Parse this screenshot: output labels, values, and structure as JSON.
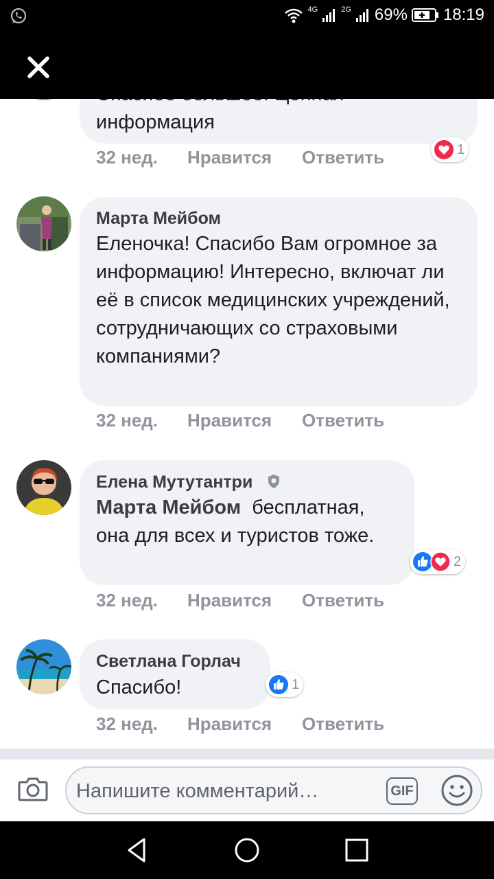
{
  "status_bar": {
    "network_1": "4G",
    "network_2": "2G",
    "battery": "69%",
    "time": "18:19"
  },
  "comments": [
    {
      "author": "",
      "text": "Спасибо большое! Ценная информация",
      "time": "32 нед.",
      "like_label": "Нравится",
      "reply_label": "Ответить",
      "reactions": [
        "heart"
      ],
      "reaction_count": "1"
    },
    {
      "author": "Марта Мейбом",
      "text": "Еленочка! Спасибо Вам огромное за информацию! Интересно, включат ли её в список медицинских учреждений, сотрудничающих со страховыми компаниями?",
      "time": "32 нед.",
      "like_label": "Нравится",
      "reply_label": "Ответить"
    },
    {
      "author": "Елена Мутутантри",
      "author_badge": "shield-icon",
      "mention": "Марта Мейбом",
      "text": "бесплатная, она для всех и туристов тоже.",
      "time": "32 нед.",
      "like_label": "Нравится",
      "reply_label": "Ответить",
      "reactions": [
        "like",
        "heart"
      ],
      "reaction_count": "2"
    },
    {
      "author": "Светлана Горлач",
      "text": "Спасибо!",
      "time": "32 нед.",
      "like_label": "Нравится",
      "reply_label": "Ответить",
      "reactions": [
        "like"
      ],
      "reaction_count": "1"
    }
  ],
  "composer": {
    "placeholder": "Напишите комментарий…",
    "gif_label": "GIF"
  },
  "colors": {
    "like_blue": "#1877f2",
    "heart_red": "#f02849",
    "bubble": "#f0f2f5",
    "meta_gray": "#90949c"
  }
}
